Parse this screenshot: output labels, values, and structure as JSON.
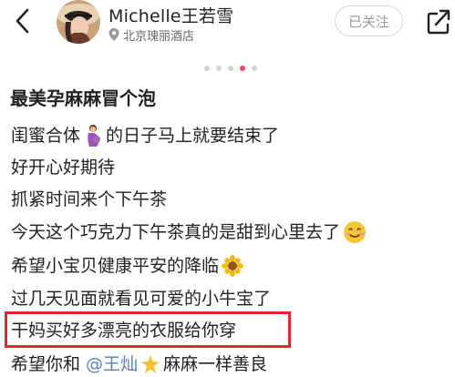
{
  "header": {
    "username": "Michelle王若雪",
    "location": "北京瑰丽酒店",
    "follow_label": "已关注"
  },
  "carousel": {
    "total": 5,
    "active_index": 3
  },
  "post": {
    "title": "最美孕麻麻冒个泡",
    "lines": [
      {
        "before": "闺蜜合体",
        "after": "的日子马上就要结束了"
      },
      {
        "text": "好开心好期待"
      },
      {
        "text": "抓紧时间来个下午茶"
      },
      {
        "text": "今天这个巧克力下午茶真的是甜到心里去了"
      },
      {
        "text": "希望小宝贝健康平安的降临"
      },
      {
        "text": "过几天见面就看见可爱的小牛宝了"
      },
      {
        "text": "干妈买好多漂亮的衣服给你穿"
      },
      {
        "before": "希望你和",
        "mention": "@王灿",
        "after": "麻麻一样善良"
      }
    ]
  },
  "icons": {
    "back": "back-chevron-icon",
    "location": "location-pin-icon",
    "share": "share-icon",
    "pregnant_emoji": "pregnant-woman-emoji",
    "smile_emoji": "smiling-face-emoji",
    "sunflower_emoji": "sunflower-emoji",
    "star_emoji": "sparkle-star-emoji"
  },
  "colors": {
    "accent_dot": "#f04a64",
    "highlight_box": "#e0262c",
    "mention": "#5a7fb0"
  }
}
